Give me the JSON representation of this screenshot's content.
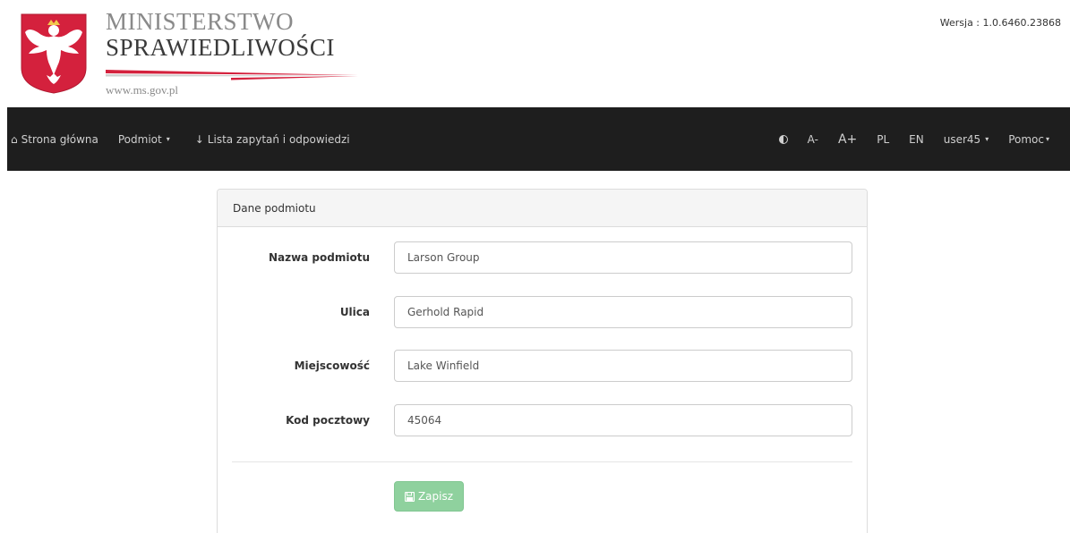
{
  "header": {
    "logo_line1": "MINISTERSTWO",
    "logo_line2": "SPRAWIEDLIWOŚCI",
    "logo_url": "www.ms.gov.pl",
    "version": "Wersja : 1.0.6460.23868"
  },
  "navbar": {
    "home_label": "Strona główna",
    "podmiot_label": "Podmiot",
    "list_label": "Lista zapytań i odpowiedzi",
    "font_smaller": "A-",
    "font_larger": "A+",
    "lang_pl": "PL",
    "lang_en": "EN",
    "user_label": "user45",
    "help_label": "Pomoc",
    "icons": [
      "home-icon",
      "caret-down-icon",
      "sort-numeric-icon",
      "contrast-icon"
    ]
  },
  "panel": {
    "heading": "Dane podmiotu",
    "fields": [
      {
        "label": "Nazwa podmiotu",
        "value": "Larson Group"
      },
      {
        "label": "Ulica",
        "value": "Gerhold Rapid"
      },
      {
        "label": "Miejscowość",
        "value": "Lake Winfield"
      },
      {
        "label": "Kod pocztowy",
        "value": "45064"
      }
    ],
    "save_label": "Zapisz"
  },
  "colors": {
    "navbar_bg": "#1e1e1e",
    "save_button": "#8fd19e",
    "emblem_red": "#d4213d"
  }
}
